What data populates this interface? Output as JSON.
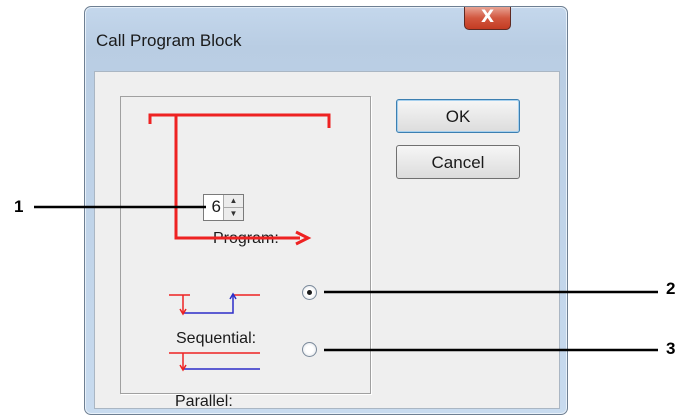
{
  "window": {
    "title": "Call Program Block",
    "close_label": "X"
  },
  "buttons": {
    "ok": "OK",
    "cancel": "Cancel"
  },
  "program": {
    "label": "Program:",
    "value": "6"
  },
  "options": {
    "sequential": {
      "label": "Sequential:",
      "selected": true
    },
    "parallel": {
      "label": "Parallel:",
      "selected": false
    }
  },
  "callouts": [
    "1",
    "2",
    "3"
  ],
  "colors": {
    "diagram_red": "#ee2222",
    "diagram_blue": "#2d2dc8"
  },
  "icons": {
    "spin_up": "▲",
    "spin_down": "▼"
  }
}
